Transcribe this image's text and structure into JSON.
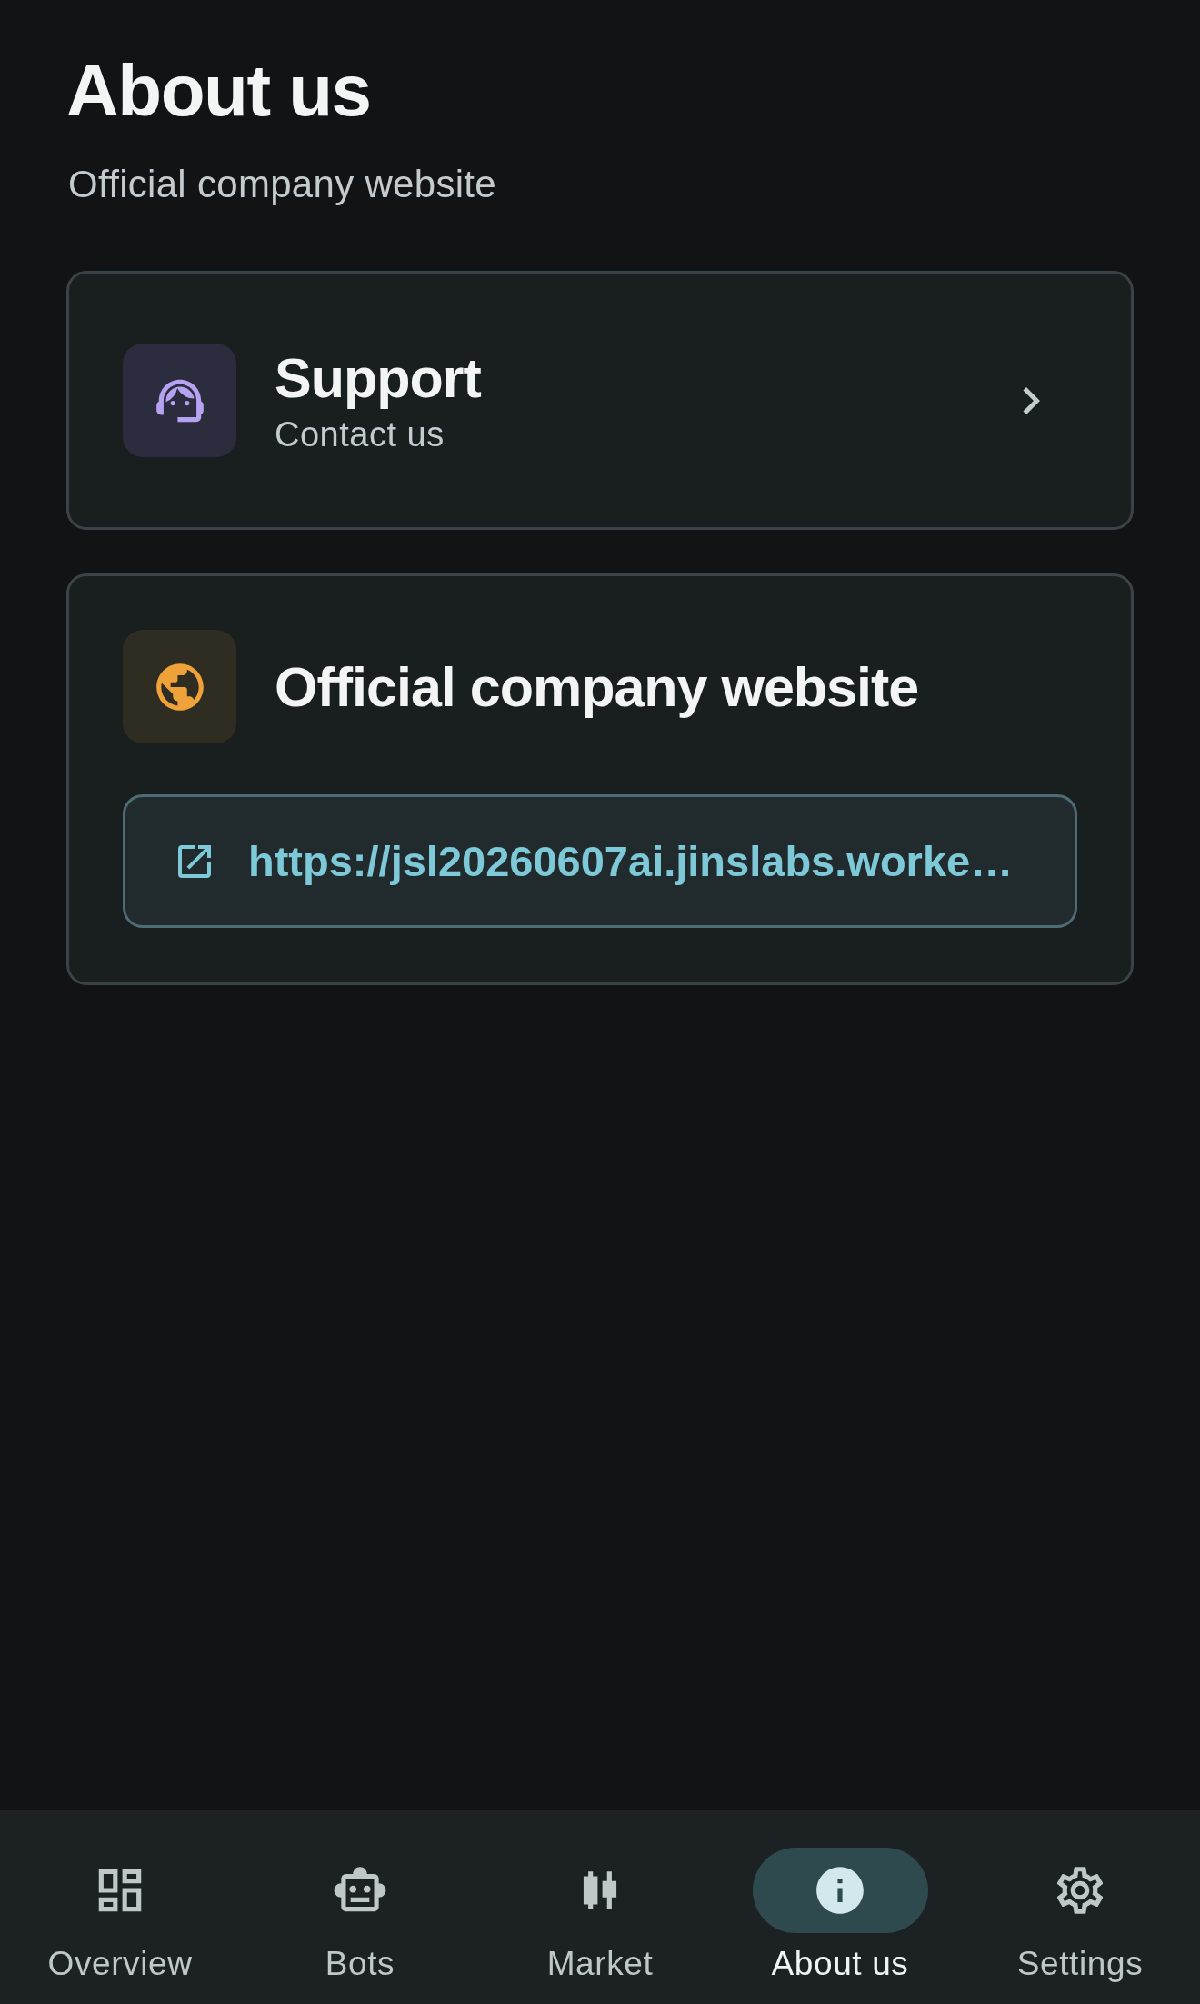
{
  "header": {
    "title": "About us",
    "subtitle": "Official company website"
  },
  "support_card": {
    "title": "Support",
    "subtitle": "Contact us"
  },
  "website_card": {
    "title": "Official company website",
    "link": "https://jsl20260607ai.jinslabs.worke…"
  },
  "bottom_nav": [
    {
      "label": "Overview",
      "selected": false
    },
    {
      "label": "Bots",
      "selected": false
    },
    {
      "label": "Market",
      "selected": false
    },
    {
      "label": "About us",
      "selected": true
    },
    {
      "label": "Settings",
      "selected": false
    }
  ]
}
